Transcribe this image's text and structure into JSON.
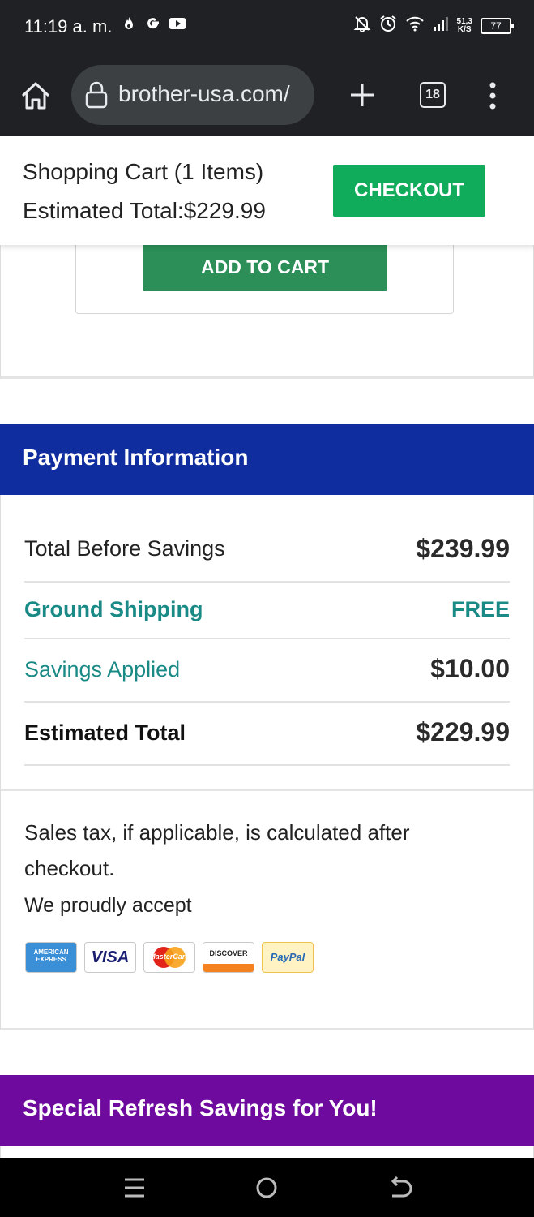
{
  "status_bar": {
    "time": "11:19 a. m.",
    "left_icons": [
      "fire-icon",
      "google-icon",
      "youtube-icon"
    ],
    "right_icons": [
      "mute-bell-icon",
      "alarm-icon",
      "wifi-icon",
      "signal-icon"
    ],
    "speed_value": "51,3",
    "speed_unit": "K/S",
    "battery": "77"
  },
  "browser": {
    "url": "brother-usa.com/",
    "tab_count": "18"
  },
  "cart_header": {
    "count_label": "Shopping Cart (1 Items)",
    "total_label": "Estimated Total:$229.99",
    "checkout_label": "CHECKOUT"
  },
  "product": {
    "add_to_cart_label": "ADD TO CART"
  },
  "payment": {
    "title": "Payment Information",
    "rows": [
      {
        "label": "Total Before Savings",
        "value": "$239.99"
      },
      {
        "label": "Ground Shipping",
        "value": "FREE"
      },
      {
        "label": "Savings Applied",
        "value": "$10.00"
      },
      {
        "label": "Estimated Total",
        "value": "$229.99"
      }
    ],
    "tax_note": "Sales tax, if applicable, is calculated after checkout.",
    "accept_label": "We proudly accept",
    "cards": [
      {
        "name": "amex",
        "text_top": "AMERICAN",
        "text_bottom": "EXPRESS"
      },
      {
        "name": "visa",
        "text": "VISA"
      },
      {
        "name": "mastercard",
        "text": "MasterCard"
      },
      {
        "name": "discover",
        "text": "DISCOVER"
      },
      {
        "name": "paypal",
        "text": "PayPal"
      }
    ]
  },
  "special": {
    "title": "Special Refresh Savings for You!"
  },
  "colors": {
    "checkout_green": "#10ac5c",
    "add_to_cart_green": "#2b8f57",
    "payment_blue": "#0f2d9f",
    "teal_text": "#1a8a86",
    "special_purple": "#6e0a9e"
  }
}
